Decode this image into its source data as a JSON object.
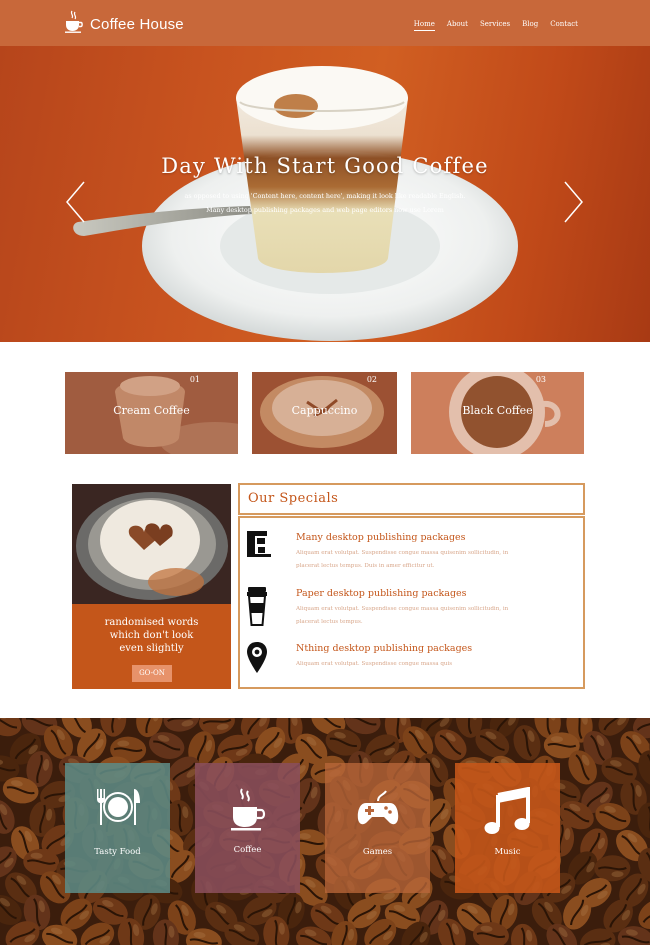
{
  "header": {
    "brand": "Coffee House",
    "nav": [
      "Home",
      "About",
      "Services",
      "Blog",
      "Contact"
    ]
  },
  "hero": {
    "title": "Day With Start Good Coffee",
    "subtitle_line1": "as opposed to using 'Content here, content here', making it look like readable English.",
    "subtitle_line2": "Many desktop publishing packages and web page editors now use Lorem"
  },
  "categories": [
    {
      "num": "01",
      "label": "Cream Coffee"
    },
    {
      "num": "02",
      "label": "Cappuccino"
    },
    {
      "num": "03",
      "label": "Black Coffee"
    }
  ],
  "specials": {
    "title": "Our Specials",
    "box_line1": "randomised words",
    "box_line2": "which don't look",
    "box_line3": "even slightly",
    "button": "GO-ON",
    "items": [
      {
        "title": "Many desktop publishing packages",
        "text1": "Aliquam erat volutpat. Suspendisse congue massa quisenim sollicitudin, in",
        "text2": "placerat lectus tempus. Duis in amer efficitur ut.",
        "icon": "coffee-machine-icon"
      },
      {
        "title": "Paper desktop publishing packages",
        "text1": "Aliquam erat volutpat. Suspendisse congue massa quisenim sollicitudin, in",
        "text2": "placerat lectus tempus.",
        "icon": "takeaway-cup-icon"
      },
      {
        "title": "Nthing desktop publishing packages",
        "text1": "Aliquam erat volutpat. Suspendisse congue massa quis",
        "text2": "",
        "icon": "location-pin-icon"
      }
    ]
  },
  "services": [
    {
      "label": "Tasty Food",
      "icon": "cutlery-icon",
      "color": "#5d8a84"
    },
    {
      "label": "Coffee",
      "icon": "coffee-cup-icon",
      "color": "#8a4e5b"
    },
    {
      "label": "Games",
      "icon": "gamepad-icon",
      "color": "#b8663a"
    },
    {
      "label": "Music",
      "icon": "music-note-icon",
      "color": "#c4561a"
    }
  ],
  "colors": {
    "accent": "#c8683a",
    "orange": "#c4561a",
    "border": "#d69a5e"
  }
}
